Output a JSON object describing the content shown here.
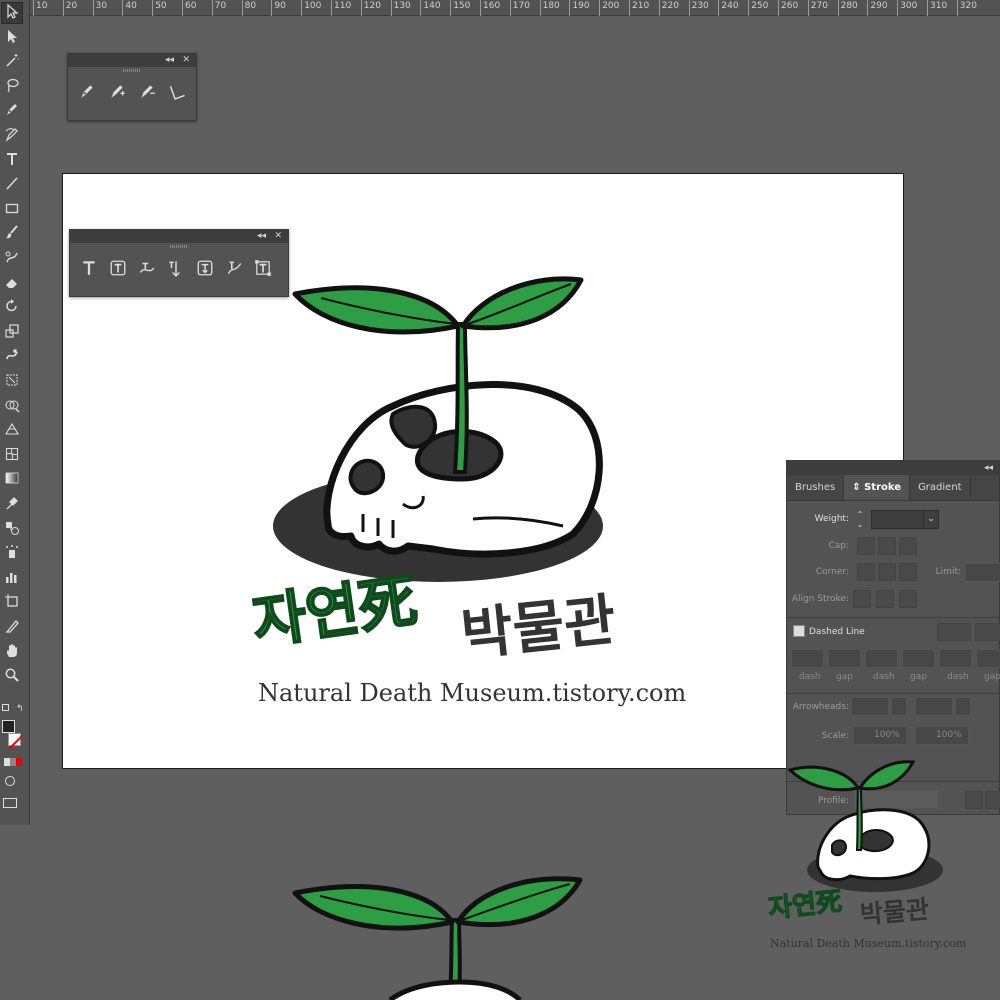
{
  "ruler": {
    "marks": [
      "10",
      "20",
      "30",
      "40",
      "50",
      "60",
      "70",
      "80",
      "90",
      "100",
      "110",
      "120",
      "130",
      "140",
      "150",
      "160",
      "170",
      "180",
      "190",
      "200",
      "210",
      "220",
      "230",
      "240",
      "250",
      "260",
      "270",
      "280",
      "290",
      "300",
      "310",
      "320"
    ]
  },
  "toolbar": {
    "tools": [
      {
        "name": "selection-tool",
        "icon": "arrow-outline-icon"
      },
      {
        "name": "direct-selection-tool",
        "icon": "arrow-filled-icon"
      },
      {
        "name": "magic-wand-tool",
        "icon": "magic-wand-icon"
      },
      {
        "name": "lasso-tool",
        "icon": "lasso-icon"
      },
      {
        "name": "pen-tool",
        "icon": "pen-icon"
      },
      {
        "name": "curvature-tool",
        "icon": "curvature-pen-icon"
      },
      {
        "name": "type-tool",
        "icon": "type-icon"
      },
      {
        "name": "line-tool",
        "icon": "line-icon"
      },
      {
        "name": "rectangle-tool",
        "icon": "rectangle-icon"
      },
      {
        "name": "paintbrush-tool",
        "icon": "brush-icon"
      },
      {
        "name": "shaper-tool",
        "icon": "shaper-icon"
      },
      {
        "name": "eraser-tool",
        "icon": "eraser-icon"
      },
      {
        "name": "rotate-tool",
        "icon": "rotate-icon"
      },
      {
        "name": "scale-tool",
        "icon": "scale-icon"
      },
      {
        "name": "warp-tool",
        "icon": "warp-icon"
      },
      {
        "name": "free-transform-tool",
        "icon": "free-transform-icon"
      },
      {
        "name": "shape-builder-tool",
        "icon": "shape-builder-icon"
      },
      {
        "name": "perspective-grid-tool",
        "icon": "perspective-icon"
      },
      {
        "name": "mesh-tool",
        "icon": "mesh-icon"
      },
      {
        "name": "gradient-tool",
        "icon": "gradient-icon"
      },
      {
        "name": "eyedropper-tool",
        "icon": "eyedropper-icon"
      },
      {
        "name": "blend-tool",
        "icon": "blend-icon"
      },
      {
        "name": "symbol-sprayer-tool",
        "icon": "symbol-sprayer-icon"
      },
      {
        "name": "graph-tool",
        "icon": "column-graph-icon"
      },
      {
        "name": "artboard-tool",
        "icon": "artboard-icon"
      },
      {
        "name": "slice-tool",
        "icon": "slice-icon"
      },
      {
        "name": "hand-tool",
        "icon": "hand-icon"
      },
      {
        "name": "zoom-tool",
        "icon": "zoom-icon"
      }
    ]
  },
  "pen_panel": {
    "tools": [
      "pen-icon",
      "add-anchor-icon",
      "delete-anchor-icon",
      "anchor-point-icon"
    ]
  },
  "type_panel": {
    "tools": [
      "type-icon",
      "area-type-icon",
      "type-on-path-icon",
      "vertical-type-icon",
      "vertical-area-type-icon",
      "vertical-type-on-path-icon",
      "touch-type-icon"
    ]
  },
  "logo": {
    "korean_green": "자연死",
    "korean_dark": "박물관",
    "url": "Natural Death Museum.tistory.com",
    "colors": {
      "leaf": "#2e9e44",
      "stem": "#1f8a3a",
      "text_green": "#2a9a3c",
      "text_dark": "#333333",
      "shadow": "#333333"
    }
  },
  "stroke_panel": {
    "tabs": [
      "Brushes",
      "Stroke",
      "Gradient"
    ],
    "active_tab": "Stroke",
    "weight_label": "Weight:",
    "weight_value": "",
    "cap_label": "Cap:",
    "corner_label": "Corner:",
    "limit_label": "Limit:",
    "align_label": "Align Stroke:",
    "dashed_label": "Dashed Line",
    "dash_labels": [
      "dash",
      "gap",
      "dash",
      "gap",
      "dash",
      "gap"
    ],
    "arrowheads_label": "Arrowheads:",
    "scale_label": "Scale:",
    "scale_1": "100%",
    "scale_2": "100%",
    "profile_label": "Profile:"
  }
}
